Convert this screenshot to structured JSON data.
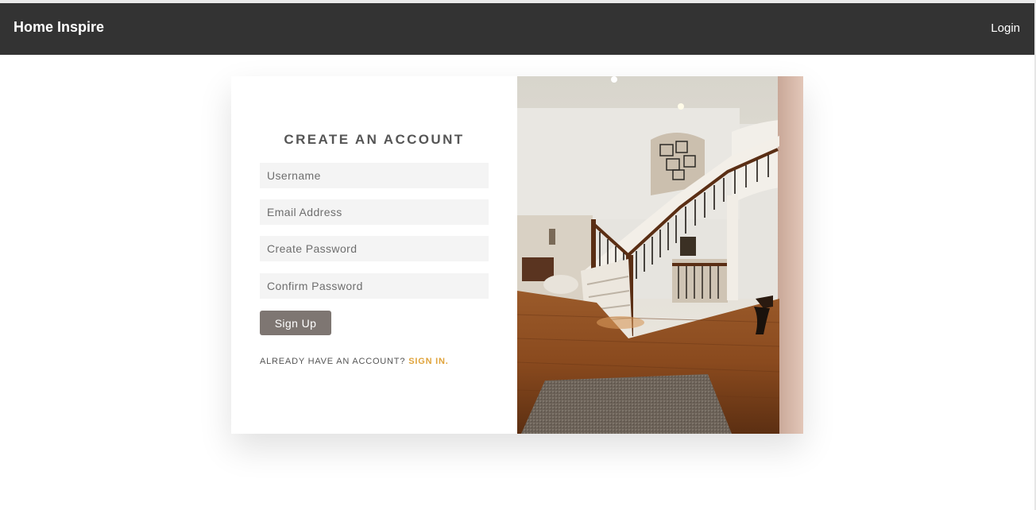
{
  "navbar": {
    "brand": "Home Inspire",
    "login_label": "Login"
  },
  "signup_form": {
    "title": "CREATE AN ACCOUNT",
    "username_placeholder": "Username",
    "email_placeholder": "Email Address",
    "password_placeholder": "Create Password",
    "confirm_placeholder": "Confirm Password",
    "submit_label": "Sign Up",
    "already_text": "ALREADY HAVE AN ACCOUNT?",
    "signin_label": "SIGN IN."
  },
  "colors": {
    "navbar_bg": "#333333",
    "button_bg": "#7e7672",
    "link_accent": "#e0a33a",
    "input_bg": "#f4f4f4"
  },
  "hero_image": {
    "description_icon": "interior-staircase-photo"
  }
}
